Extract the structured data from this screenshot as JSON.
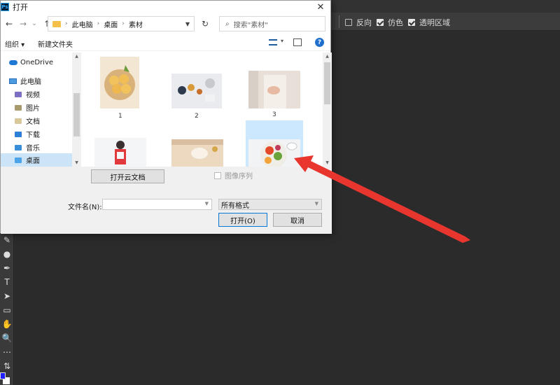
{
  "dialog": {
    "title": "打开",
    "app_icon": "Ps",
    "close_glyph": "✕"
  },
  "nav": {
    "back": "←",
    "forward": "→",
    "recent": "⌄",
    "up": "↑",
    "breadcrumb": [
      "此电脑",
      "桌面",
      "素材"
    ],
    "refresh": "↻",
    "search_placeholder": "搜索\"素材\""
  },
  "commands": {
    "organize": "组织 ▾",
    "new_folder": "新建文件夹",
    "help": "?"
  },
  "sidebar": {
    "items": [
      {
        "label": "OneDrive",
        "icon": "cloud-icon"
      },
      {
        "label": "此电脑",
        "icon": "computer-icon"
      },
      {
        "label": "视频",
        "icon": "video-folder-icon"
      },
      {
        "label": "图片",
        "icon": "picture-folder-icon"
      },
      {
        "label": "文档",
        "icon": "document-folder-icon"
      },
      {
        "label": "下载",
        "icon": "download-folder-icon"
      },
      {
        "label": "音乐",
        "icon": "music-folder-icon"
      },
      {
        "label": "桌面",
        "icon": "desktop-folder-icon",
        "selected": true
      }
    ]
  },
  "files": [
    {
      "name": "1"
    },
    {
      "name": "2"
    },
    {
      "name": "3"
    },
    {
      "name": ""
    },
    {
      "name": ""
    },
    {
      "name": "",
      "selected": true
    }
  ],
  "bottom": {
    "open_cloud": "打开云文档",
    "image_sequence": "图像序列",
    "filename_label": "文件名(N):",
    "filename_value": "",
    "format_value": "所有格式",
    "open_button": "打开(O)",
    "cancel_button": "取消"
  },
  "photoshop": {
    "options": [
      {
        "label": "反向",
        "checked": false
      },
      {
        "label": "仿色",
        "checked": true
      },
      {
        "label": "透明区域",
        "checked": true
      }
    ],
    "tools": [
      "✎",
      "●",
      "✒",
      "T",
      "➤",
      "▭",
      "✋",
      "🔍",
      "⋯",
      "⇅"
    ]
  },
  "colors": {
    "selection": "#cce8ff",
    "accent": "#0078d7",
    "annotation_arrow": "#e8352e",
    "ps_background": "#2b2b2b"
  }
}
